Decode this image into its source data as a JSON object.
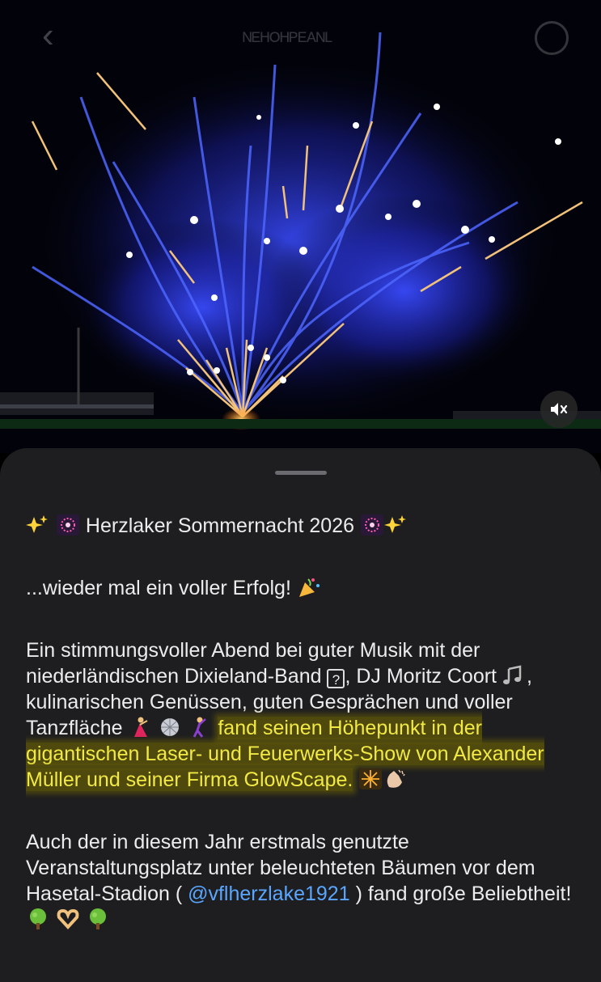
{
  "header": {
    "title": "ᴺᴱᴴᴼᴴᴾᴱᴬᴺᴸ"
  },
  "media": {
    "description_icon": "fireworks-video",
    "mute_icon": "speaker-muted-icon"
  },
  "caption": {
    "title": "Herzlaker Sommernacht 2026",
    "line2": "...wieder mal ein voller Erfolg!",
    "p3_a": "Ein stimmungsvoller Abend bei guter Musik mit der niederländischen Dixieland-Band",
    "p3_q": "?",
    "p3_b": ", DJ Moritz Coort",
    "p3_c": ", kulinarischen Genüssen, guten Gesprächen und voller Tanzfläche",
    "p3_highlight": "fand seinen Höhepunkt in der gigantischen Laser- und Feuerwerks-Show von Alexander Müller und seiner Firma GlowScape.",
    "p4_a": "Auch der in diesem Jahr erstmals genutzte Veranstaltungsplatz unter beleuchteten Bäumen vor dem Hasetal-Stadion (",
    "p4_mention": "@vflherzlake1921",
    "p4_b": ") fand große Beliebtheit!"
  },
  "colors": {
    "sheet": "#1e1e20",
    "text": "#ececec",
    "highlight": "#f2ea44",
    "mention": "#5aa6ff"
  }
}
